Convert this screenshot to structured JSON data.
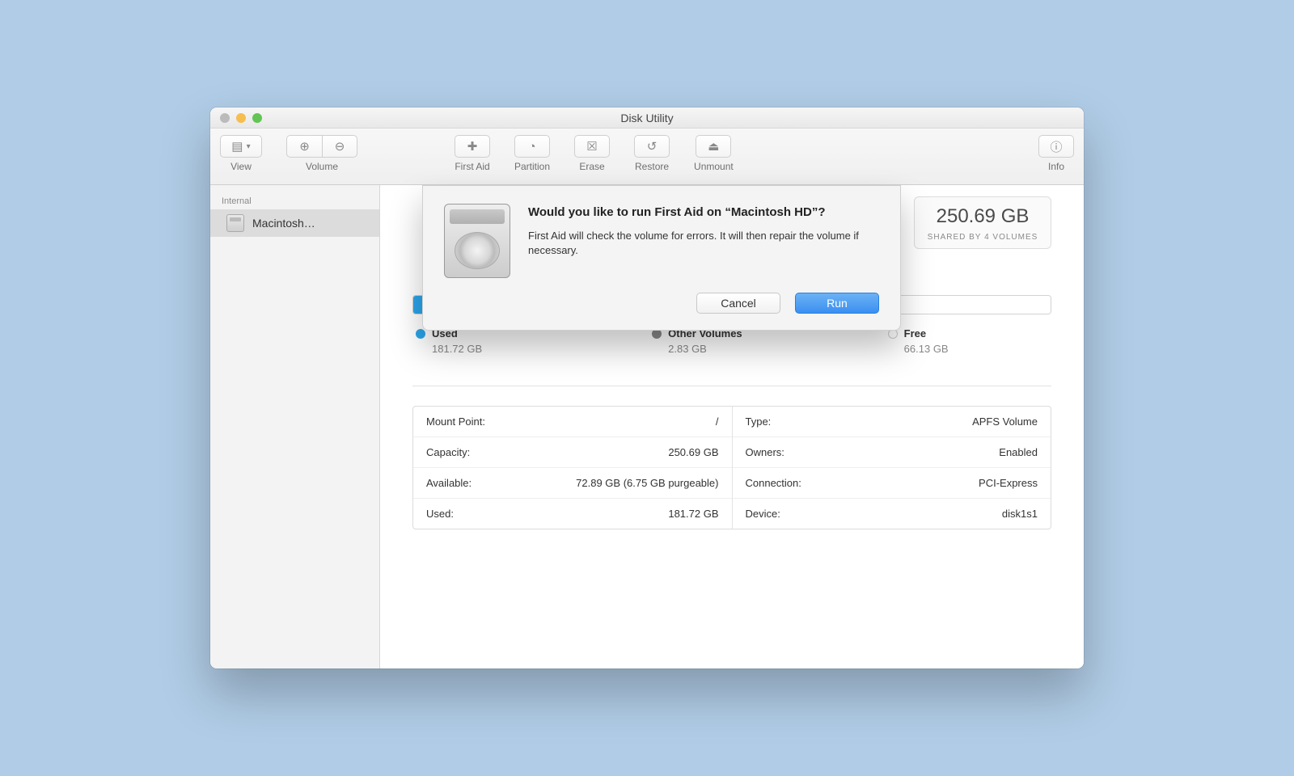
{
  "window": {
    "title": "Disk Utility"
  },
  "toolbar": {
    "view": "View",
    "volume": "Volume",
    "first_aid": "First Aid",
    "partition": "Partition",
    "erase": "Erase",
    "restore": "Restore",
    "unmount": "Unmount",
    "info": "Info"
  },
  "sidebar": {
    "header": "Internal",
    "items": [
      {
        "label": "Macintosh…"
      }
    ]
  },
  "capacity": {
    "value": "250.69 GB",
    "caption": "SHARED BY 4 VOLUMES"
  },
  "usage": {
    "used": {
      "label": "Used",
      "value": "181.72 GB"
    },
    "other": {
      "label": "Other Volumes",
      "value": "2.83 GB"
    },
    "free": {
      "label": "Free",
      "value": "66.13 GB"
    }
  },
  "info": {
    "left": [
      {
        "k": "Mount Point:",
        "v": "/"
      },
      {
        "k": "Capacity:",
        "v": "250.69 GB"
      },
      {
        "k": "Available:",
        "v": "72.89 GB (6.75 GB purgeable)"
      },
      {
        "k": "Used:",
        "v": "181.72 GB"
      }
    ],
    "right": [
      {
        "k": "Type:",
        "v": "APFS Volume"
      },
      {
        "k": "Owners:",
        "v": "Enabled"
      },
      {
        "k": "Connection:",
        "v": "PCI-Express"
      },
      {
        "k": "Device:",
        "v": "disk1s1"
      }
    ]
  },
  "dialog": {
    "heading": "Would you like to run First Aid on “Macintosh HD”?",
    "body": "First Aid will check the volume for errors. It will then repair the volume if necessary.",
    "cancel": "Cancel",
    "run": "Run"
  }
}
